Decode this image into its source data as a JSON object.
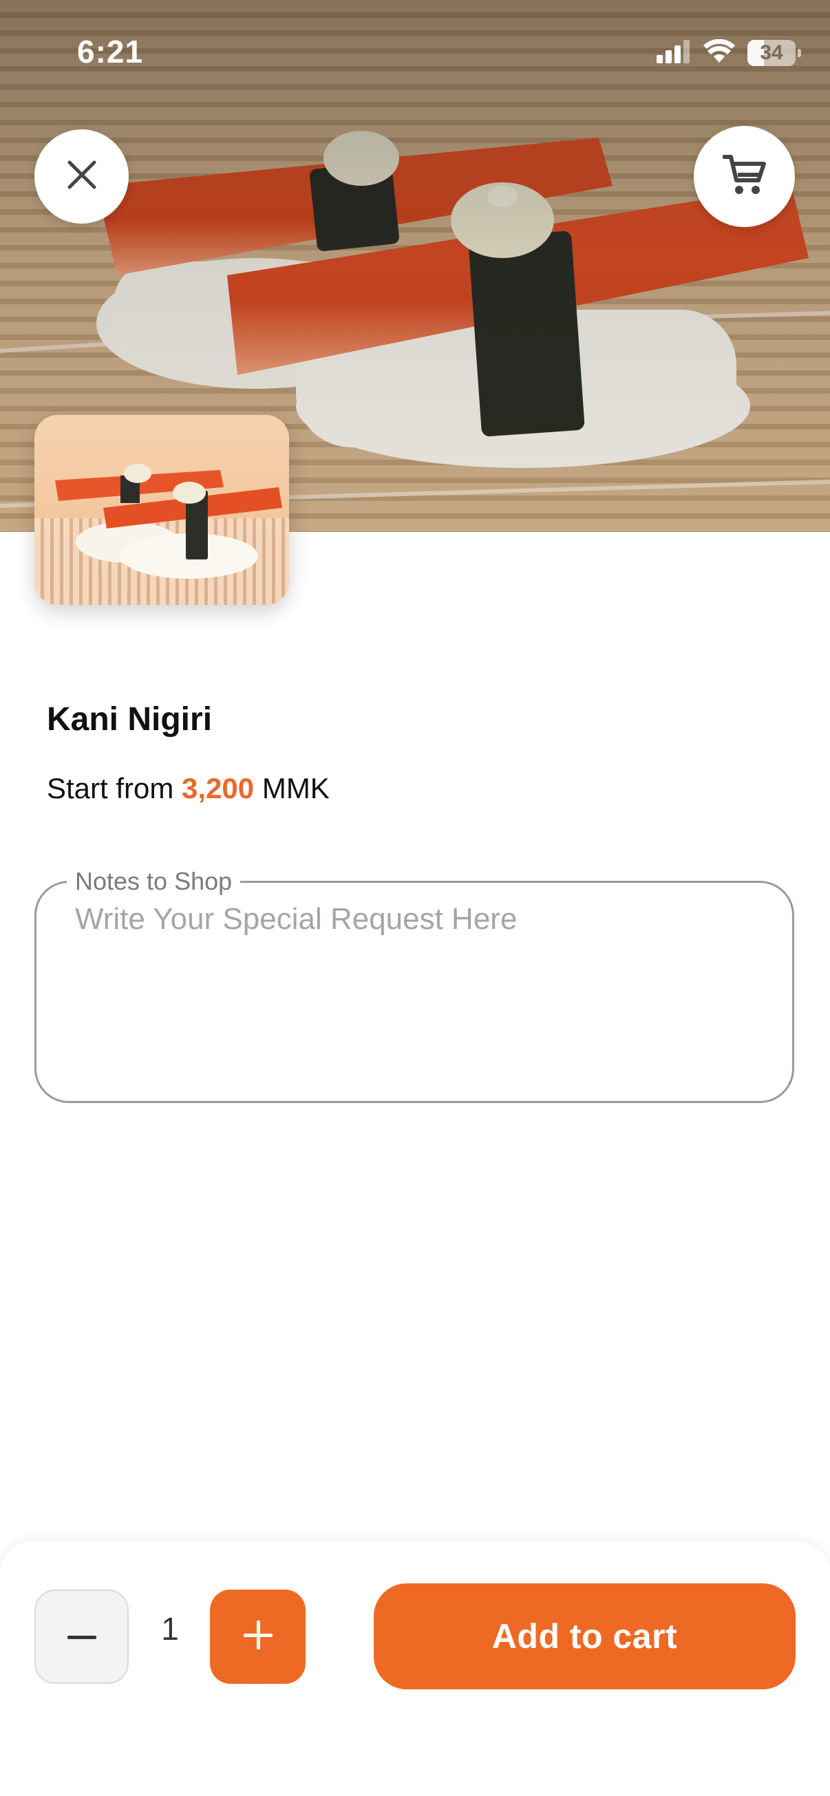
{
  "status_bar": {
    "time": "6:21",
    "battery": "34",
    "battery_level": 0.34
  },
  "product": {
    "name": "Kani Nigiri",
    "price_prefix": "Start from",
    "price": "3,200",
    "currency": "MMK"
  },
  "notes": {
    "label": "Notes to Shop",
    "placeholder": "Write Your Special Request Here",
    "value": ""
  },
  "quantity": {
    "value": "1"
  },
  "actions": {
    "add_to_cart": "Add to cart"
  },
  "icons": {
    "close": "close-icon",
    "cart": "cart-icon",
    "minus": "minus-icon",
    "plus": "plus-icon",
    "signal": "signal-icon",
    "wifi": "wifi-icon",
    "battery": "battery-icon"
  },
  "colors": {
    "accent": "#ee6a24",
    "price": "#e8692a"
  }
}
